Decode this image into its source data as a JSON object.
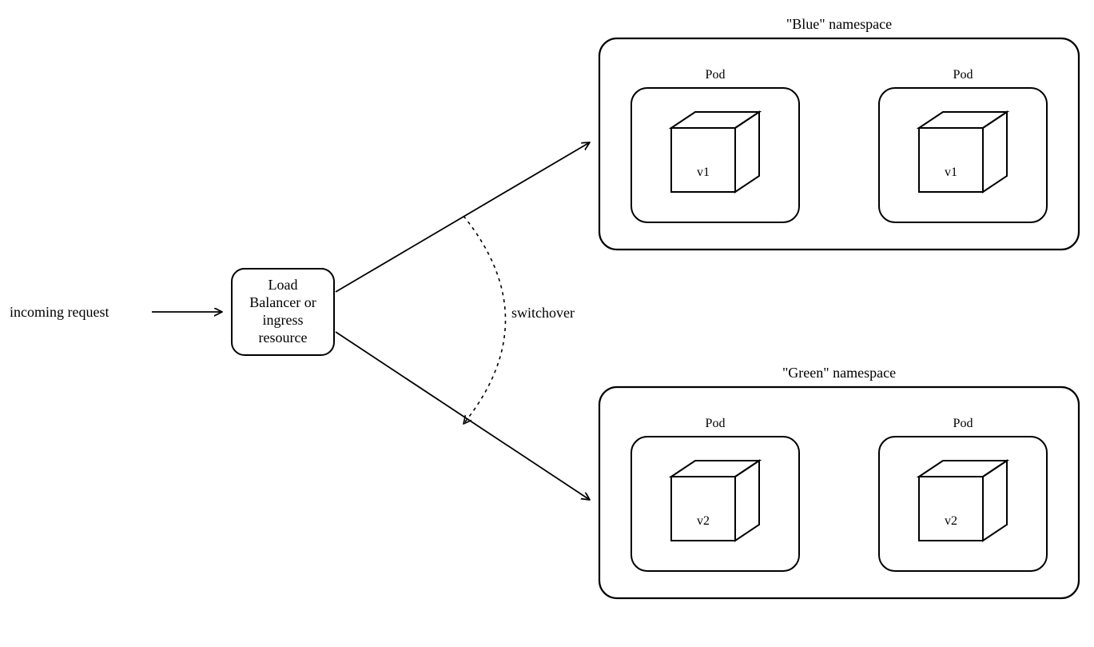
{
  "incoming_label": "incoming request",
  "load_balancer": {
    "line1": "Load",
    "line2": "Balancer or",
    "line3": "ingress",
    "line4": "resource"
  },
  "switchover_label": "switchover",
  "blue": {
    "title": "\"Blue\" namespace",
    "pod_label": "Pod",
    "version": "v1"
  },
  "green": {
    "title": "\"Green\" namespace",
    "pod_label": "Pod",
    "version": "v2"
  }
}
